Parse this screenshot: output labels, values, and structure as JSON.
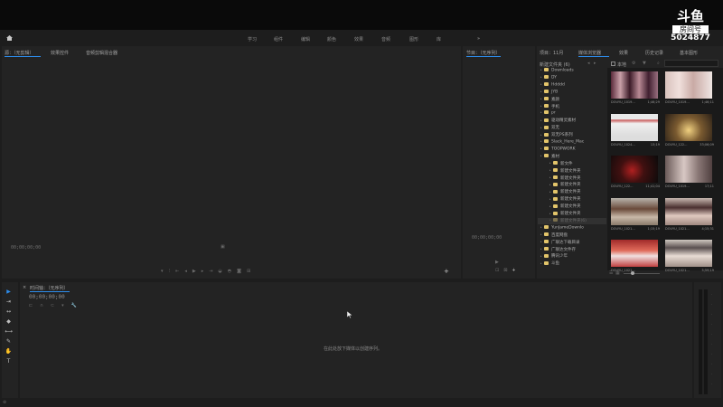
{
  "workspaces": [
    "学习",
    "组件",
    "编辑",
    "颜色",
    "效果",
    "音频",
    "图形",
    "库"
  ],
  "more_glyph": "»",
  "watermark": {
    "logo": "斗鱼",
    "label": "房间号",
    "room": "5024877"
  },
  "source_panel": {
    "tabs": [
      "源：（无剪辑）",
      "效果控件",
      "音频剪辑混合器"
    ],
    "timecode": "00;00;00;00"
  },
  "program_panel": {
    "tab": "节目：（无序列）",
    "timecode": "00;00;00;00"
  },
  "project_panel": {
    "tabs": [
      "项目：11月",
      "媒体浏览器",
      "效果",
      "历史记录",
      "基本图形"
    ],
    "path_label": "新建文件夹 (6)",
    "search_placeholder": "",
    "view_label": "本地",
    "tree": [
      {
        "name": "Downloads",
        "depth": 0
      },
      {
        "name": "DY",
        "depth": 0
      },
      {
        "name": "Hdddd",
        "depth": 0
      },
      {
        "name": "JYB",
        "depth": 0
      },
      {
        "name": "素颜",
        "depth": 0
      },
      {
        "name": "手机",
        "depth": 0
      },
      {
        "name": "pr",
        "depth": 0
      },
      {
        "name": "驱动精灵素材",
        "depth": 0
      },
      {
        "name": "双无",
        "depth": 0
      },
      {
        "name": "双无PS系列",
        "depth": 0
      },
      {
        "name": "Slack_Here_Mac",
        "depth": 0
      },
      {
        "name": "TOOPWORK",
        "depth": 0
      },
      {
        "name": "素材",
        "depth": 0
      },
      {
        "name": "新文件",
        "depth": 1
      },
      {
        "name": "新建文件夹",
        "depth": 1
      },
      {
        "name": "新建文件夹",
        "depth": 1
      },
      {
        "name": "新建文件夹",
        "depth": 1
      },
      {
        "name": "新建文件夹",
        "depth": 1
      },
      {
        "name": "新建文件夹",
        "depth": 1
      },
      {
        "name": "新建文件夹",
        "depth": 1
      },
      {
        "name": "新建文件夹",
        "depth": 1
      },
      {
        "name": "新建文件夹(6)",
        "depth": 1
      },
      {
        "name": "YunJameDownlo",
        "depth": 0
      },
      {
        "name": "百度网盘",
        "depth": 0
      },
      {
        "name": "广联达下载目录",
        "depth": 0
      },
      {
        "name": "广联达文件存",
        "depth": 0
      },
      {
        "name": "腾讯少年",
        "depth": 0
      },
      {
        "name": "斗鱼",
        "depth": 0
      }
    ],
    "thumbs": [
      {
        "name": "DOUYU_1019...",
        "dur": "1;46;29"
      },
      {
        "name": "DOUYU_1019...",
        "dur": "1;46;11"
      },
      {
        "name": "DOUYU_1024...",
        "dur": "13;19"
      },
      {
        "name": "DOUYU_122...",
        "dur": "33;06;09"
      },
      {
        "name": "DOUYU_122...",
        "dur": "11;41;04"
      },
      {
        "name": "DOUYU_1019...",
        "dur": "17;11"
      },
      {
        "name": "DOUYU_1021...",
        "dur": "1;15;19"
      },
      {
        "name": "DOUYU_1021...",
        "dur": "4;15;31"
      },
      {
        "name": "DOUYU_1021...",
        "dur": ""
      },
      {
        "name": "DOUYU_1021...",
        "dur": "5;59;19"
      }
    ]
  },
  "timeline": {
    "tab": "时间轴：（无序列）",
    "timecode": "00;00;00;00",
    "empty_msg": "在此处放下媒体以创建序列。"
  },
  "tools": [
    "selection-tool-icon",
    "track-select-icon",
    "ripple-edit-icon",
    "razor-icon",
    "slip-icon",
    "pen-icon",
    "hand-icon",
    "type-icon"
  ],
  "colors": {
    "accent": "#2d8ceb",
    "folder": "#e2c46a",
    "bg": "#1d1d1d",
    "panel": "#232323"
  }
}
